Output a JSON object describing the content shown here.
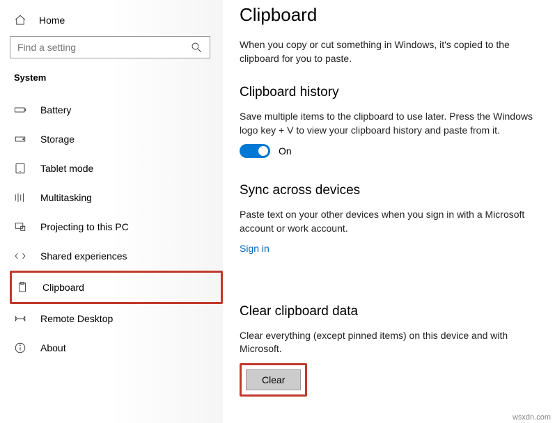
{
  "sidebar": {
    "home": "Home",
    "search_placeholder": "Find a setting",
    "category": "System",
    "items": [
      {
        "label": "Battery"
      },
      {
        "label": "Storage"
      },
      {
        "label": "Tablet mode"
      },
      {
        "label": "Multitasking"
      },
      {
        "label": "Projecting to this PC"
      },
      {
        "label": "Shared experiences"
      },
      {
        "label": "Clipboard"
      },
      {
        "label": "Remote Desktop"
      },
      {
        "label": "About"
      }
    ]
  },
  "main": {
    "title": "Clipboard",
    "intro": "When you copy or cut something in Windows, it's copied to the clipboard for you to paste.",
    "history": {
      "title": "Clipboard history",
      "desc": "Save multiple items to the clipboard to use later. Press the Windows logo key + V to view your clipboard history and paste from it.",
      "toggle_state": "On"
    },
    "sync": {
      "title": "Sync across devices",
      "desc": "Paste text on your other devices when you sign in with a Microsoft account or work account.",
      "link": "Sign in"
    },
    "clear": {
      "title": "Clear clipboard data",
      "desc": "Clear everything (except pinned items) on this device and with Microsoft.",
      "button": "Clear"
    }
  },
  "watermark": "wsxdn.com"
}
